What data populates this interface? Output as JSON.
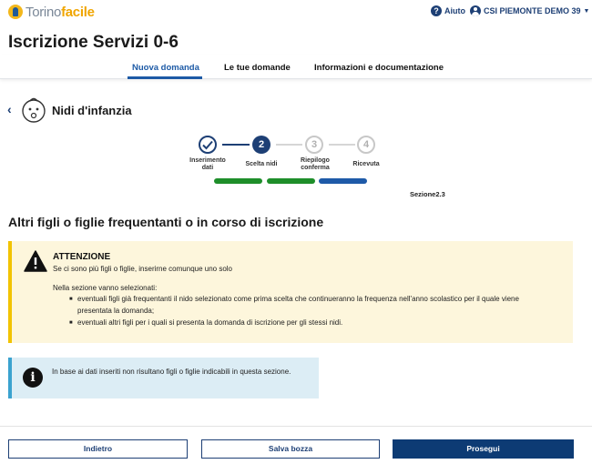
{
  "header": {
    "logo_part1": "Torino",
    "logo_part2": "facile",
    "help_label": "Aiuto",
    "user_name": "CSI PIEMONTE DEMO 39"
  },
  "page_title": "Iscrizione Servizi 0-6",
  "nav": {
    "tabs": [
      {
        "label": "Nuova domanda",
        "active": true
      },
      {
        "label": "Le tue domande",
        "active": false
      },
      {
        "label": "Informazioni e documentazione",
        "active": false
      }
    ]
  },
  "section": {
    "title": "Nidi d'infanzia"
  },
  "stepper": {
    "steps": [
      {
        "number": "✓",
        "label": "Inserimento\ndati",
        "state": "done"
      },
      {
        "number": "2",
        "label": "Scelta nidi",
        "state": "current"
      },
      {
        "number": "3",
        "label": "Riepilogo\nconferma",
        "state": "todo"
      },
      {
        "number": "4",
        "label": "Ricevuta",
        "state": "todo"
      }
    ],
    "section_label": "Sezione2.3",
    "colors": {
      "done": "#1d3f75",
      "current": "#1d3f75",
      "todo": "#c8c8c8",
      "bar_green": "#1e8e2a",
      "bar_blue": "#1e5aa8"
    }
  },
  "heading": "Altri figli o figlie frequentanti o in corso di iscrizione",
  "warning": {
    "title": "ATTENZIONE",
    "line1": "Se ci sono più figli o figlie, inserirne comunque uno solo",
    "line2": "Nella sezione vanno selezionati:",
    "bullet1a": "eventuali figli già frequentanti il nido selezionato come prima scelta che continueranno la frequenza nell'anno scolastico per il quale viene",
    "bullet1b": "presentata la domanda;",
    "bullet2": "eventuali altri figli per i quali si presenta la domanda di iscrizione per gli stessi nidi."
  },
  "info": {
    "text": "In base ai dati inseriti non risultano figli o figlie indicabili in questa sezione."
  },
  "buttons": {
    "back": "Indietro",
    "save": "Salva bozza",
    "next": "Prosegui"
  }
}
